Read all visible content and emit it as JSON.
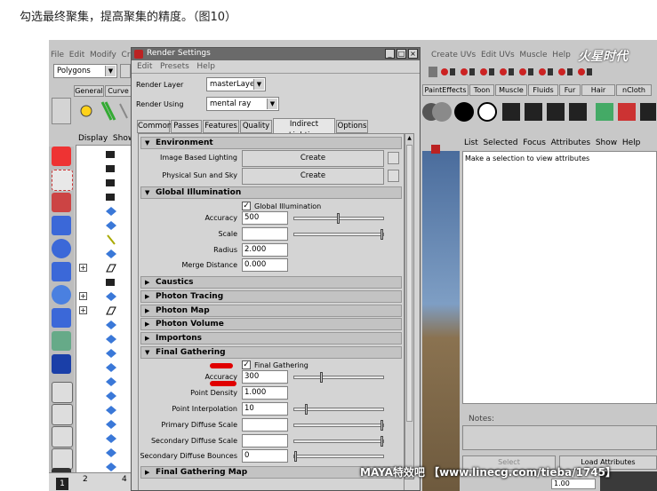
{
  "caption": "勾选最终聚集，提高聚集的精度。（图10）",
  "maya": {
    "menu_left": [
      "File",
      "Edit",
      "Modify",
      "Cr"
    ],
    "menu_right": [
      "Create UVs",
      "Edit UVs",
      "Muscle",
      "Help"
    ],
    "mode_selector": "Polygons",
    "shelf_tabs_left": [
      "General",
      "Curve"
    ],
    "shelf_tabs_right": [
      "PaintEffects",
      "Toon",
      "Muscle",
      "Fluids",
      "Fur",
      "Hair",
      "nCloth"
    ],
    "outliner_menu": [
      "Display",
      "Show"
    ],
    "attr_menu": [
      "List",
      "Selected",
      "Focus",
      "Attributes",
      "Show",
      "Help"
    ],
    "attr_message": "Make a selection to view attributes",
    "notes_label": "Notes:",
    "select_button": "Select",
    "load_attributes_button": "Load Attributes",
    "bottom_field": "1.00",
    "timeline_numbers": [
      "1",
      "2",
      "4"
    ],
    "logo_text": "火星时代"
  },
  "render_settings": {
    "title": "Render Settings",
    "menu": [
      "Edit",
      "Presets",
      "Help"
    ],
    "render_layer_label": "Render Layer",
    "render_layer_value": "masterLayer",
    "render_using_label": "Render Using",
    "render_using_value": "mental ray",
    "tabs": [
      "Common",
      "Passes",
      "Features",
      "Quality",
      "Indirect Lighting",
      "Options"
    ],
    "active_tab": "Indirect Lighting",
    "environment": {
      "title": "Environment",
      "ibl_label": "Image Based Lighting",
      "ibl_button": "Create",
      "sun_label": "Physical Sun and Sky",
      "sun_button": "Create"
    },
    "global_illumination": {
      "title": "Global Illumination",
      "checkbox_label": "Global Illumination",
      "accuracy_label": "Accuracy",
      "accuracy_value": "500",
      "scale_label": "Scale",
      "radius_label": "Radius",
      "radius_value": "2.000",
      "merge_label": "Merge Distance",
      "merge_value": "0.000"
    },
    "collapsed_sections": [
      "Caustics",
      "Photon Tracing",
      "Photon Map",
      "Photon Volume",
      "Importons"
    ],
    "final_gathering": {
      "title": "Final Gathering",
      "checkbox_label": "Final Gathering",
      "accuracy_label": "Accuracy",
      "accuracy_value": "300",
      "point_density_label": "Point Density",
      "point_density_value": "1.000",
      "point_interp_label": "Point Interpolation",
      "point_interp_value": "10",
      "primary_label": "Primary Diffuse Scale",
      "secondary_label": "Secondary Diffuse Scale",
      "bounces_label": "Secondary Diffuse Bounces",
      "bounces_value": "0"
    },
    "fg_map_title": "Final Gathering Map"
  },
  "watermark": "MAYA特效吧 【www.linecg.com/tieba/1745】",
  "colors": {
    "annotation_red": "#e00000",
    "title_bar": "#6a6a6a"
  }
}
